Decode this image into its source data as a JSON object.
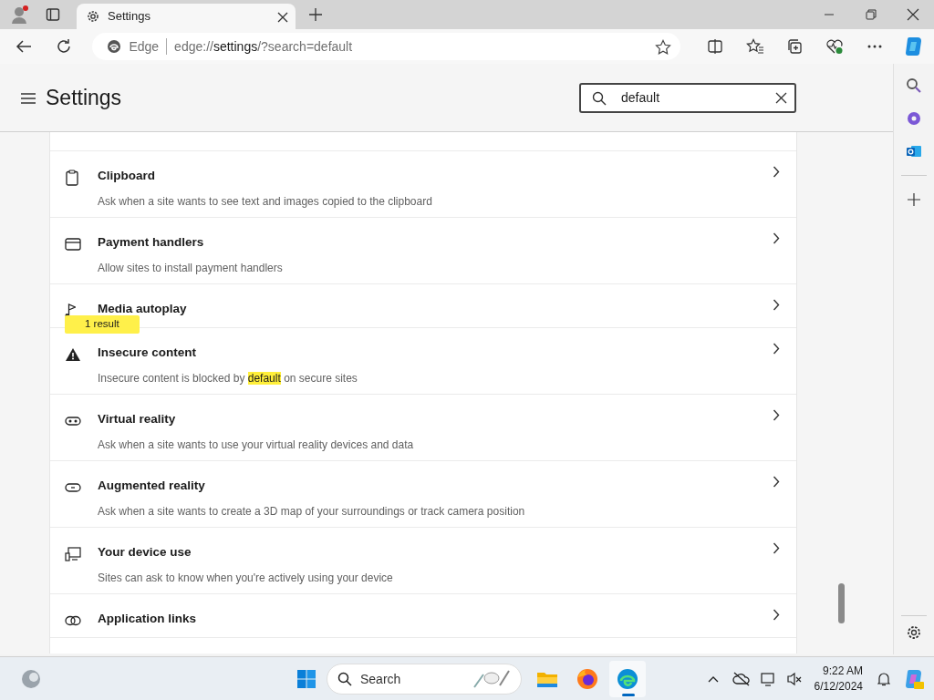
{
  "browser": {
    "tab": {
      "title": "Settings",
      "selected": true
    },
    "address": {
      "site_label": "Edge",
      "url_parts": [
        {
          "text": "edge://",
          "emphasized": false
        },
        {
          "text": "settings",
          "emphasized": true
        },
        {
          "text": "/?search=default",
          "emphasized": false
        }
      ]
    }
  },
  "settings": {
    "title": "Settings",
    "search": {
      "value": "default"
    },
    "items": [
      {
        "title": "Clipboard",
        "description": [
          {
            "text": "Ask when a site wants to see text and images copied to the clipboard",
            "highlighted": false
          }
        ]
      },
      {
        "title": "Payment handlers",
        "description": [
          {
            "text": "Allow sites to install payment handlers",
            "highlighted": false
          }
        ]
      },
      {
        "title": "Media autoplay"
      },
      {
        "title": "Insecure content",
        "search_badge": "1 result",
        "description": [
          {
            "text": "Insecure content is blocked by ",
            "highlighted": false
          },
          {
            "text": "default",
            "highlighted": true
          },
          {
            "text": " on secure sites",
            "highlighted": false
          }
        ]
      },
      {
        "title": "Virtual reality",
        "description": [
          {
            "text": "Ask when a site wants to use your virtual reality devices and data",
            "highlighted": false
          }
        ]
      },
      {
        "title": "Augmented reality",
        "description": [
          {
            "text": "Ask when a site wants to create a 3D map of your surroundings or track camera position",
            "highlighted": false
          }
        ]
      },
      {
        "title": "Your device use",
        "description": [
          {
            "text": "Sites can ask to know when you're actively using your device",
            "highlighted": false
          }
        ]
      },
      {
        "title": "Application links"
      }
    ]
  },
  "taskbar": {
    "search": {
      "placeholder": "Search"
    },
    "apps": [
      {
        "running": false
      },
      {
        "running": false
      },
      {
        "running": true
      }
    ],
    "clock": {
      "time": "9:22 AM",
      "date": "6/12/2024"
    }
  }
}
